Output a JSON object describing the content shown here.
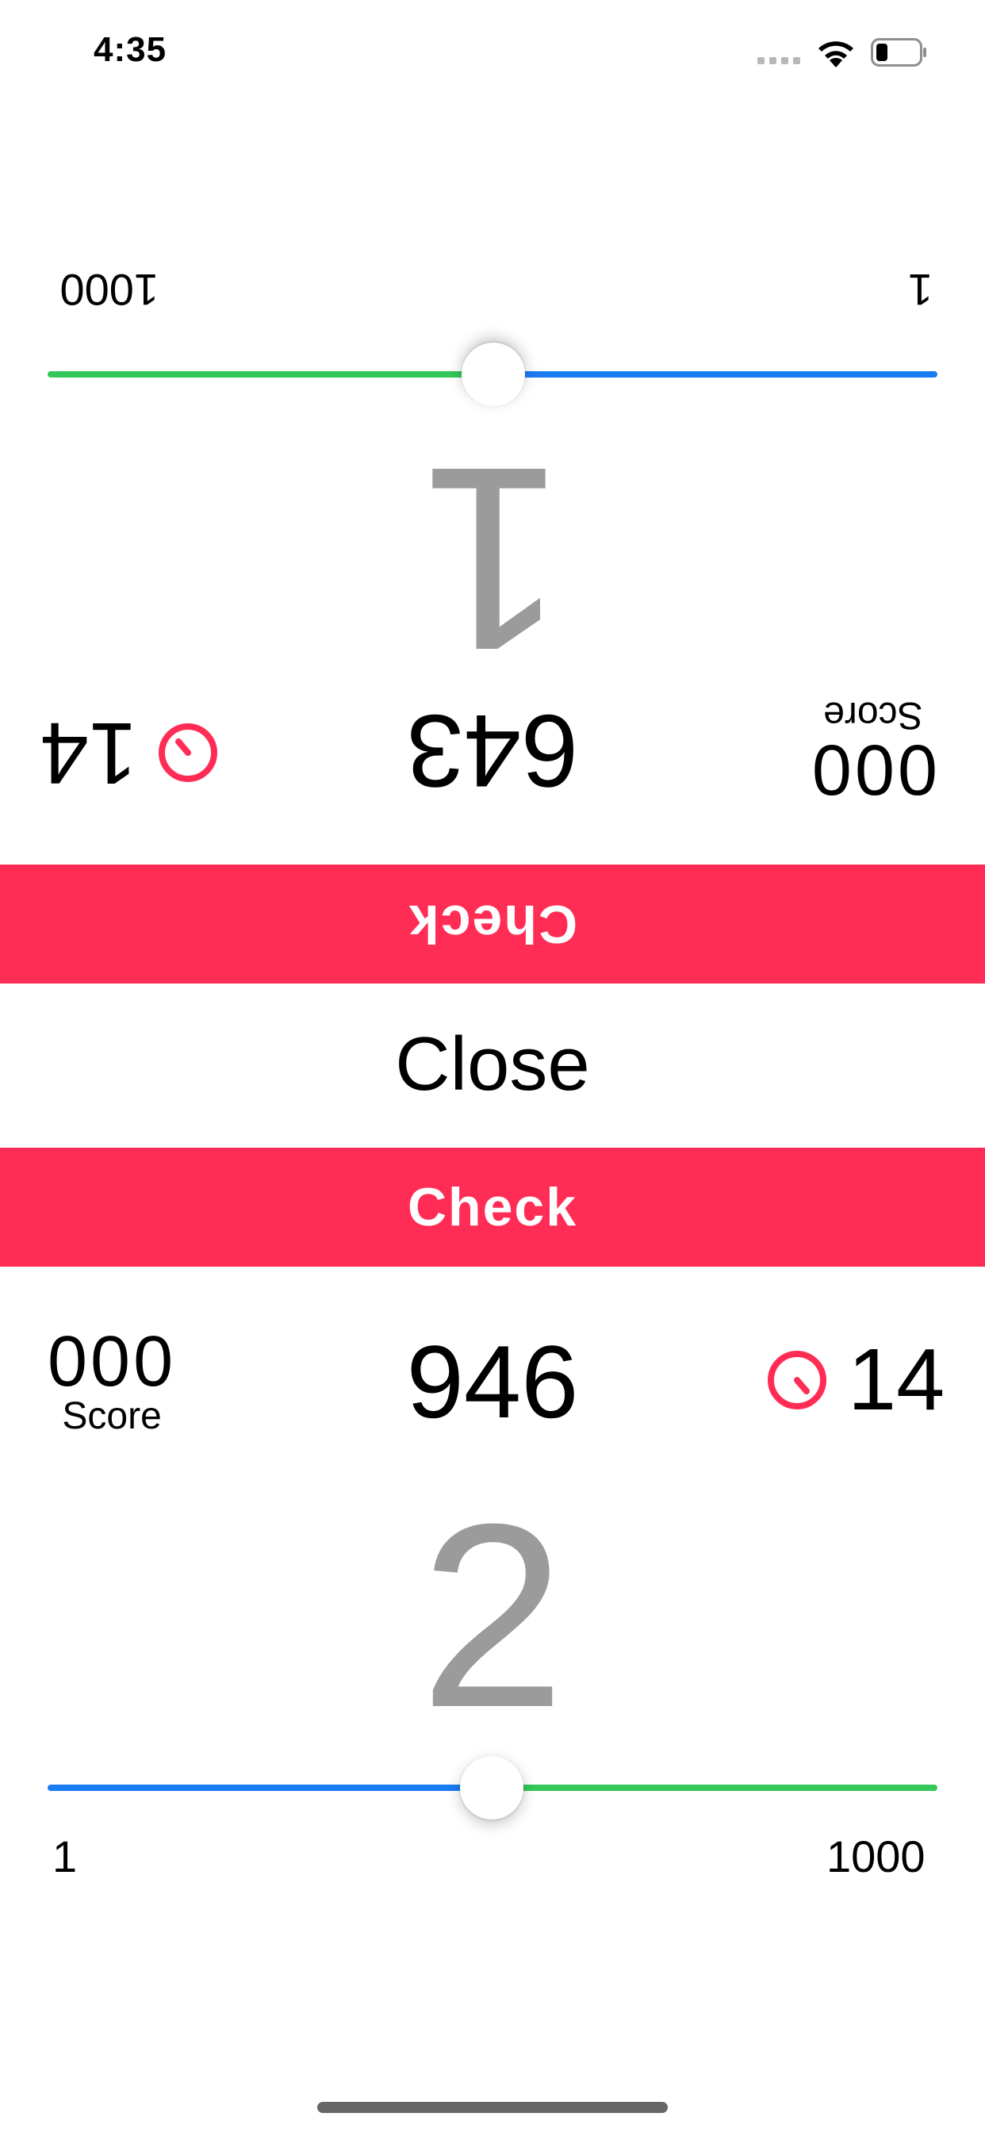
{
  "status_bar": {
    "time": "4:35"
  },
  "top_player": {
    "slider": {
      "min_label": "1",
      "max_label": "1000",
      "value": 500
    },
    "guess_digit": "1",
    "target": "643",
    "timer": "14",
    "score_value": "000",
    "score_label": "Score",
    "check_label": "Check"
  },
  "close_label": "Close",
  "bottom_player": {
    "check_label": "Check",
    "score_value": "000",
    "score_label": "Score",
    "target": "946",
    "timer": "14",
    "guess_digit": "2",
    "slider": {
      "min_label": "1",
      "max_label": "1000",
      "value": 500
    }
  },
  "colors": {
    "accent": "#ff2d55",
    "track_green": "#34c759",
    "track_blue": "#1a7cf2",
    "digit_gray": "#9b9b9b"
  }
}
